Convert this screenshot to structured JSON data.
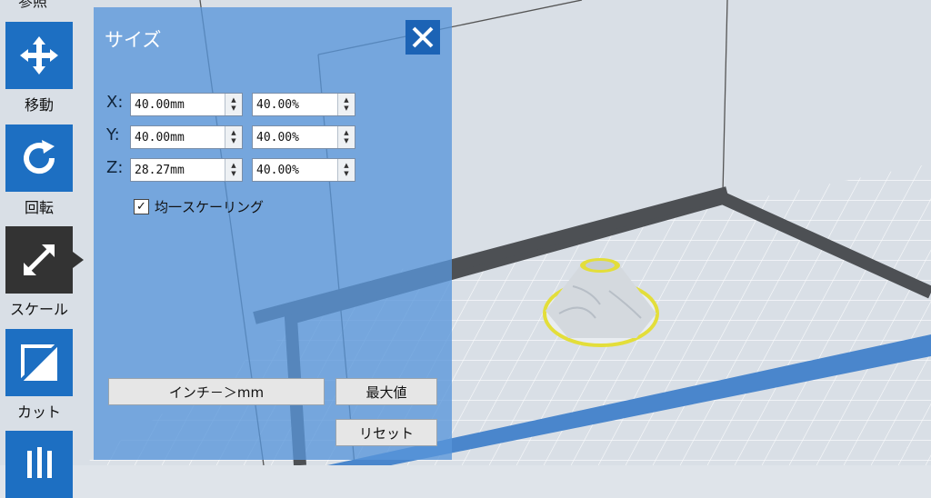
{
  "toolbar": {
    "partial_label": "参照",
    "items": [
      {
        "label": "移動",
        "icon": "move-icon"
      },
      {
        "label": "回転",
        "icon": "rotate-icon"
      },
      {
        "label": "スケール",
        "icon": "scale-icon",
        "active": true
      },
      {
        "label": "カット",
        "icon": "cut-icon"
      },
      {
        "label": "",
        "icon": "support-icon"
      }
    ]
  },
  "panel": {
    "title": "サイズ",
    "close_icon": "close-icon",
    "rows": [
      {
        "axis": "X:",
        "size": "40.00mm",
        "percent": "40.00%"
      },
      {
        "axis": "Y:",
        "size": "40.00mm",
        "percent": "40.00%"
      },
      {
        "axis": "Z:",
        "size": "28.27mm",
        "percent": "40.00%"
      }
    ],
    "uniform_scaling": {
      "label": "均一スケーリング",
      "checked": true
    },
    "buttons": {
      "inch_to_mm": "インチ－＞mm",
      "max": "最大値",
      "reset": "リセット"
    }
  },
  "colors": {
    "accent": "#1d6fc2",
    "active_tool": "#333333",
    "selection": "#e3de3a"
  }
}
